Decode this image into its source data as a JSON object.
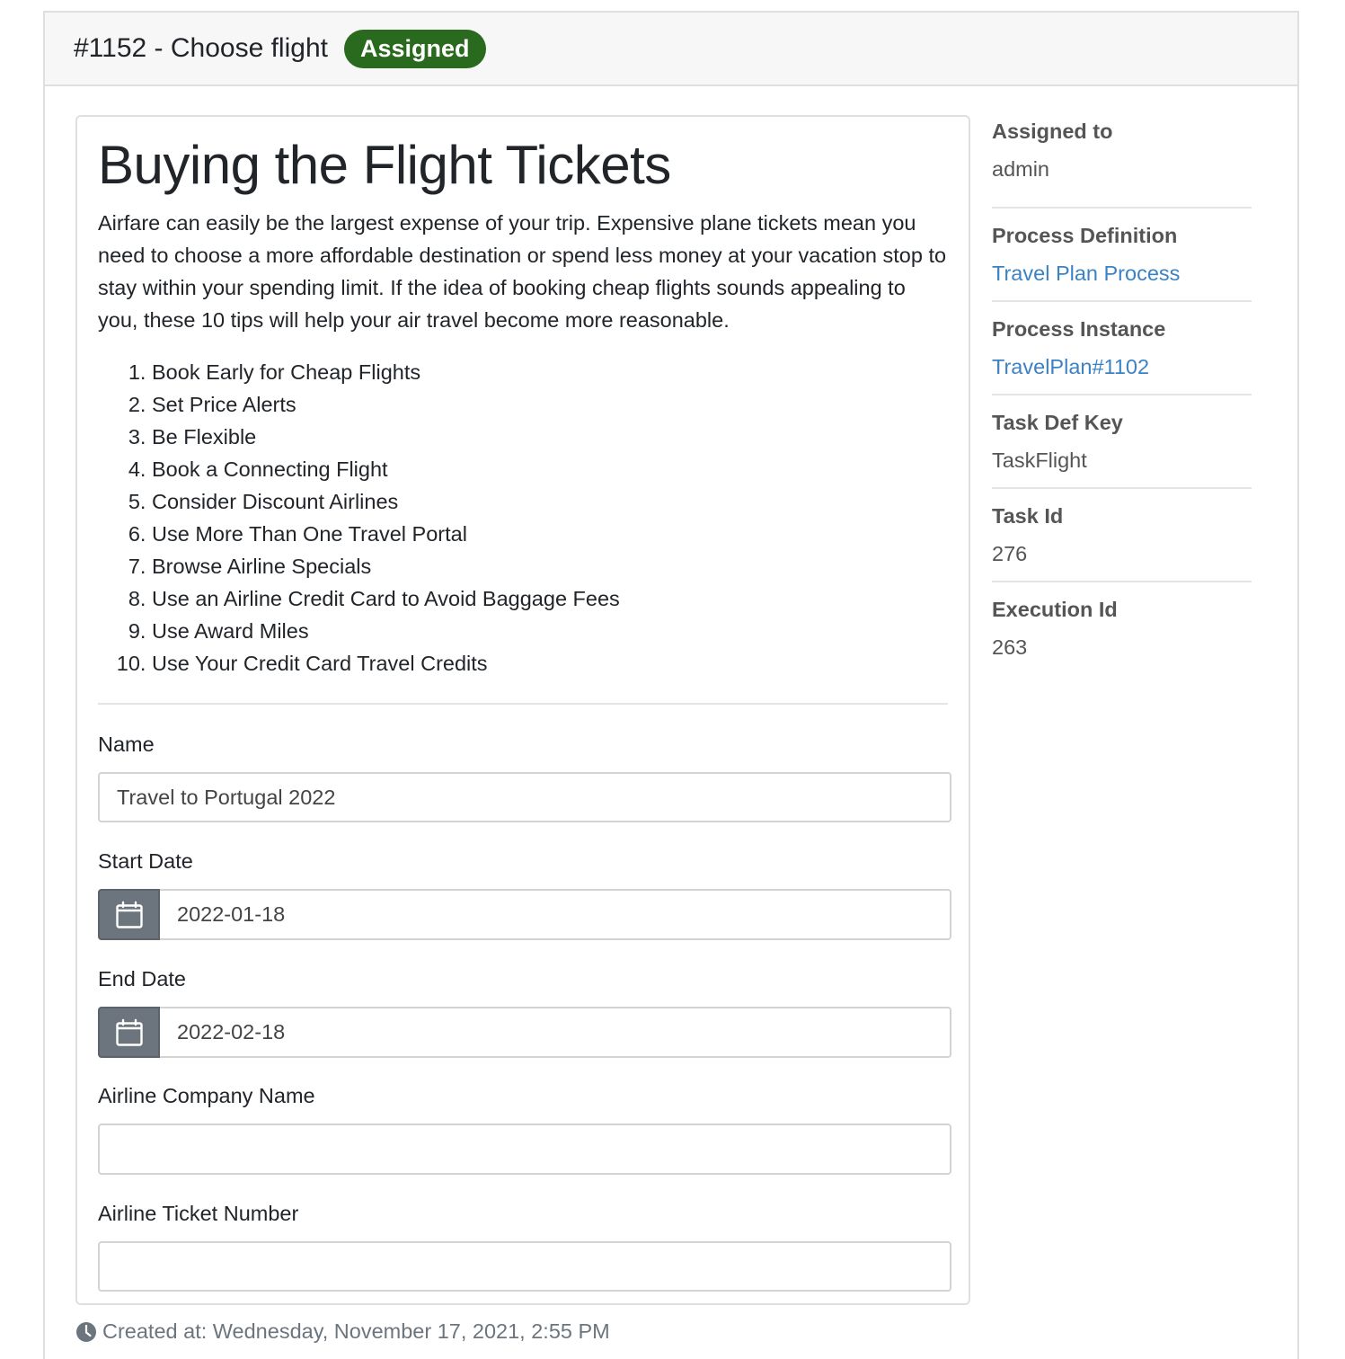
{
  "header": {
    "title": "#1152 - Choose flight",
    "status_badge": "Assigned"
  },
  "article": {
    "heading": "Buying the Flight Tickets",
    "intro": "Airfare can easily be the largest expense of your trip. Expensive plane tickets mean you need to choose a more affordable destination or spend less money at your vacation stop to stay within your spending limit. If the idea of booking cheap flights sounds appealing to you, these 10 tips will help your air travel become more reasonable.",
    "tips": [
      "Book Early for Cheap Flights",
      "Set Price Alerts",
      "Be Flexible",
      "Book a Connecting Flight",
      "Consider Discount Airlines",
      "Use More Than One Travel Portal",
      "Browse Airline Specials",
      "Use an Airline Credit Card to Avoid Baggage Fees",
      "Use Award Miles",
      "Use Your Credit Card Travel Credits"
    ]
  },
  "form": {
    "name_label": "Name",
    "name_value": "Travel to Portugal 2022",
    "start_date_label": "Start Date",
    "start_date_value": "2022-01-18",
    "end_date_label": "End Date",
    "end_date_value": "2022-02-18",
    "airline_company_label": "Airline Company Name",
    "airline_company_value": "",
    "airline_ticket_label": "Airline Ticket Number",
    "airline_ticket_value": "",
    "calendar_icon": "calendar-icon"
  },
  "sidebar": {
    "assigned_to_label": "Assigned to",
    "assigned_to_value": "admin",
    "process_definition_label": "Process Definition",
    "process_definition_value": "Travel Plan Process",
    "process_instance_label": "Process Instance",
    "process_instance_value": "TravelPlan#1102",
    "task_def_key_label": "Task Def Key",
    "task_def_key_value": "TaskFlight",
    "task_id_label": "Task Id",
    "task_id_value": "276",
    "execution_id_label": "Execution Id",
    "execution_id_value": "263"
  },
  "footer": {
    "created_at": "Created at: Wednesday, November 17, 2021, 2:55 PM",
    "clock_icon": "clock-icon"
  },
  "colors": {
    "badge_bg": "#2a6a1e",
    "link": "#3b82c4",
    "calendar_button_bg": "#6c757d"
  }
}
